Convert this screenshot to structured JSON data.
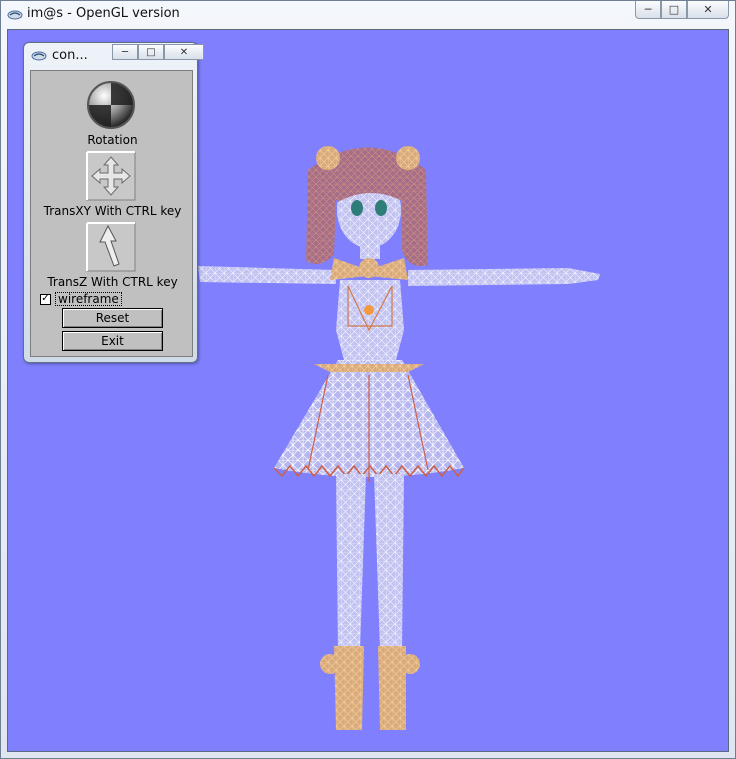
{
  "window": {
    "title": "im@s - OpenGL version",
    "controls": {
      "minimize": "─",
      "maximize": "□",
      "close": "✕"
    }
  },
  "panel": {
    "title": "con...",
    "controls": {
      "minimize": "─",
      "maximize": "□",
      "close": "✕"
    },
    "rotation_label": "Rotation",
    "transxy_label": "TransXY With CTRL key",
    "transz_label": "TransZ With CTRL key",
    "wireframe_label": "wireframe",
    "wireframe_checked": "✓",
    "reset_label": "Reset",
    "exit_label": "Exit"
  },
  "colors": {
    "viewport_background": "#8080ff",
    "wireframe_light": "#e8e8f8",
    "wireframe_accent": "#f2a05a",
    "hair": "#b06a5a"
  }
}
